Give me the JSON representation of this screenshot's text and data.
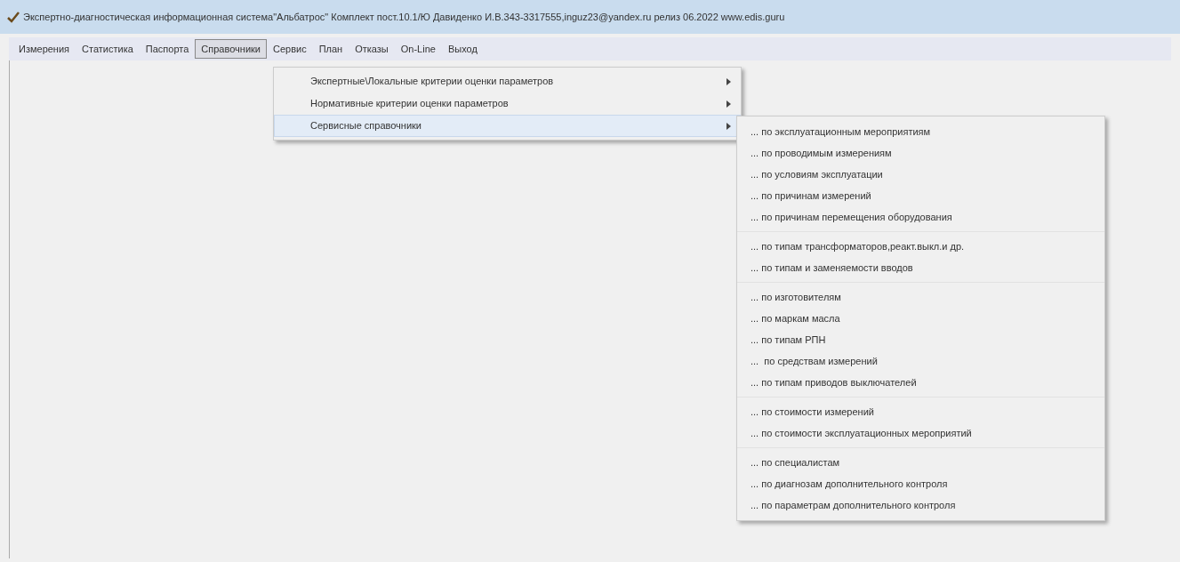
{
  "window": {
    "title": "Экспертно-диагностическая информационная система\"Альбатрос\" Комплект пост.10.1/Ю Давиденко И.В.343-3317555,inguz23@yandex.ru релиз 06.2022 www.edis.guru"
  },
  "menu_bar": [
    {
      "label": "Измерения",
      "selected": false
    },
    {
      "label": "Статистика",
      "selected": false
    },
    {
      "label": "Паспорта",
      "selected": false
    },
    {
      "label": "Справочники",
      "selected": true
    },
    {
      "label": "Сервис",
      "selected": false
    },
    {
      "label": "План",
      "selected": false
    },
    {
      "label": "Отказы",
      "selected": false
    },
    {
      "label": "On-Line",
      "selected": false
    },
    {
      "label": "Выход",
      "selected": false
    }
  ],
  "dropdown": [
    {
      "label": "Экспертные\\Локальные критерии оценки параметров",
      "selected": false
    },
    {
      "label": "Нормативные критерии оценки параметров",
      "selected": false
    },
    {
      "label": "Сервисные справочники",
      "selected": true
    }
  ],
  "submenu": [
    [
      {
        "label": "... по эксплуатационным мероприятиям"
      },
      {
        "label": "... по проводимым измерениям"
      },
      {
        "label": "... по условиям эксплуатации"
      },
      {
        "label": "... по причинам измерений"
      },
      {
        "label": "... по причинам перемещения оборудования"
      }
    ],
    [
      {
        "label": "... по типам трансформаторов,реакт.выкл.и др."
      },
      {
        "label": "... по типам и заменяемости вводов"
      }
    ],
    [
      {
        "label": "... по изготовителям"
      },
      {
        "label": "... по маркам масла"
      },
      {
        "label": "... по типам РПН"
      },
      {
        "label": "...  по средствам измерений"
      },
      {
        "label": "... по типам приводов выключателей"
      }
    ],
    [
      {
        "label": "... по стоимости измерений"
      },
      {
        "label": "... по стоимости эксплуатационных мероприятий"
      }
    ],
    [
      {
        "label": "... по специалистам"
      },
      {
        "label": "... по диагнозам дополнительного контроля"
      },
      {
        "label": "... по параметрам дополнительного контроля"
      }
    ]
  ]
}
